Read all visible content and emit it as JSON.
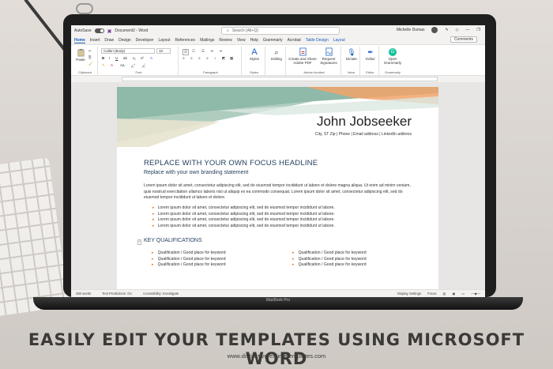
{
  "window": {
    "autosave_label": "AutoSave",
    "doc_name": "Document2 - Word",
    "search_placeholder": "Search (Alt+Q)",
    "user_name": "Michelle Dumas"
  },
  "tabs": [
    "Home",
    "Insert",
    "Draw",
    "Design",
    "Developer",
    "Layout",
    "References",
    "Mailings",
    "Review",
    "View",
    "Help",
    "Grammarly",
    "Acrobat",
    "Table Design",
    "Layout"
  ],
  "comments_label": "Comments",
  "ribbon": {
    "clipboard_label": "Clipboard",
    "paste_label": "Paste",
    "font_name": "Calibri (Body)",
    "font_size": "10",
    "font_label": "Font",
    "paragraph_label": "Paragraph",
    "styles_btn": "Styles",
    "styles_label": "Styles",
    "editing_btn": "Editing",
    "create_share_btn": "Create and Share Adobe PDF",
    "request_sig_btn": "Request Signatures",
    "acrobat_label": "Adobe Acrobat",
    "dictate_btn": "Dictate",
    "voice_label": "Voice",
    "editor_btn": "Editor",
    "editor_label": "Editor",
    "grammarly_btn": "Open Grammarly",
    "grammarly_label": "Grammarly"
  },
  "resume": {
    "name": "John Jobseeker",
    "contact": "City, ST Zip  |  Phone  |  Email address  |  LinkedIn address",
    "headline": "REPLACE WITH YOUR OWN FOCUS HEADLINE",
    "branding": "Replace with your own branding statement",
    "summary": "Lorem ipsum dolor sit amet, consectetur adipiscing elit, sed do eiusmod tempor incididunt ut labore et dolore magna aliqua. Ut enim ad minim veniam, quis nostrud exercitation ullamco laboris nisi ut aliquip ex ea commodo consequat. Lorem ipsum dolor sit amet, consectetur adipiscing elit, sed do eiusmod tempor incididunt ut labore et dolore.",
    "bullets": [
      "Lorem ipsum dolor sit amet, consectetur adipiscing elit, sed do eiusmod tempor incididunt ut labore.",
      "Lorem ipsum dolor sit amet, consectetur adipiscing elit, sed do eiusmod tempor incididunt ut labore.",
      "Lorem ipsum dolor sit amet, consectetur adipiscing elit, sed do eiusmod tempor incididunt ut labore.",
      "Lorem ipsum dolor sit amet, consectetur adipiscing elit, sed do eiusmod tempor incididunt ut labore."
    ],
    "qualifications_heading": "KEY QUALIFICATIONS",
    "qualifications_left": [
      "Qualification / Good place for keyword",
      "Qualification / Good place for keyword",
      "Qualification / Good place for keyword"
    ],
    "qualifications_right": [
      "Qualification / Good place for keyword",
      "Qualification / Good place for keyword",
      "Qualification / Good place for keyword"
    ]
  },
  "statusbar": {
    "words": "250 words",
    "text_predictions": "Text Predictions: On",
    "accessibility": "Accessibility: Investigate",
    "display_settings": "Display Settings",
    "focus": "Focus"
  },
  "device_label": "MacBook Pro",
  "caption": "EASILY EDIT YOUR TEMPLATES USING MICROSOFT WORD",
  "website": "www.distinctiveresumetemplates.com",
  "colors": {
    "accent_blue": "#185abd",
    "banner_teal": "#8fb9a8",
    "banner_peach": "#f2a36a",
    "bullet_orange": "#e07b3c",
    "heading_navy": "#1f3b5a"
  }
}
